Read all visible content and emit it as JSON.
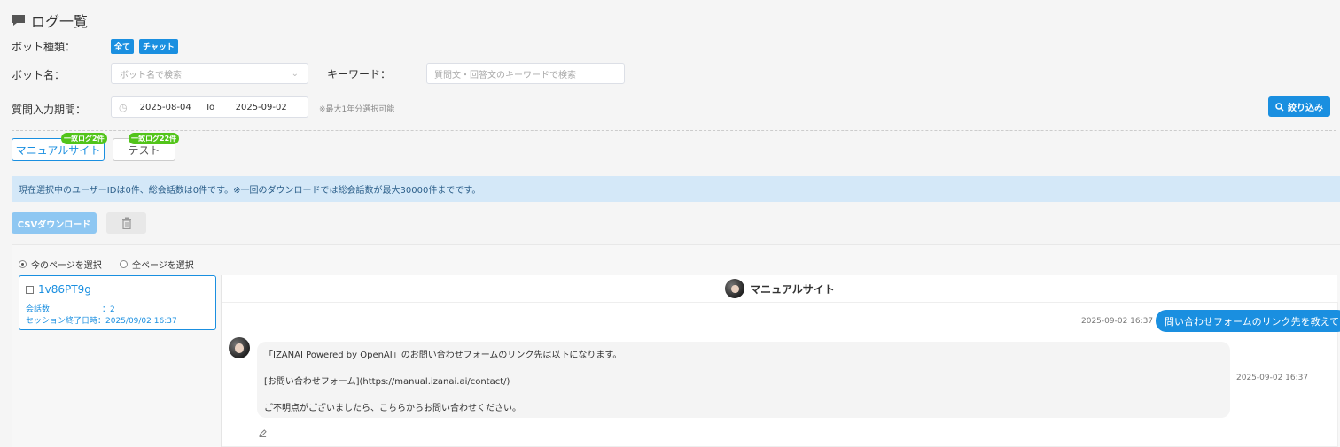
{
  "page": {
    "title": "ログ一覧"
  },
  "filters": {
    "bot_type_label": "ボット種類：",
    "bot_type_tags": [
      "全て",
      "チャット"
    ],
    "bot_name_label": "ボット名：",
    "bot_name_placeholder": "ボット名で検索",
    "keyword_label": "キーワード：",
    "keyword_placeholder": "質問文・回答文のキーワードで検索",
    "period_label": "質問入力期間：",
    "date_from": "2025-08-04",
    "date_to_sep": "To",
    "date_to": "2025-09-02",
    "period_note": "※最大1年分選択可能",
    "filter_button": "絞り込み"
  },
  "bot_tabs": [
    {
      "label": "マニュアルサイト",
      "badge": "一致ログ2件",
      "active": true
    },
    {
      "label": "テスト",
      "badge": "一致ログ22件",
      "active": false
    }
  ],
  "info_bar": "現在選択中のユーザーIDは0件、総会話数は0件です。※一回のダウンロードでは総会話数が最大30000件までです。",
  "actions": {
    "csv_button": "CSVダウンロード"
  },
  "selection": {
    "current_page": "今のページを選択",
    "all_pages": "全ページを選択",
    "selected": "current_page"
  },
  "sessions": [
    {
      "id": "1v86PT9g",
      "count_label": "会話数",
      "count_value": "：2",
      "end_label": "セッション終了日時",
      "end_value": "：2025/09/02 16:37"
    }
  ],
  "chat": {
    "bot_name": "マニュアルサイト",
    "user_message": "問い合わせフォームのリンク先を教えて",
    "user_time": "2025-09-02 16:37",
    "bot_lines": [
      "「IZANAI Powered by OpenAI」のお問い合わせフォームのリンク先は以下になります。",
      "[お問い合わせフォーム](https://manual.izanai.ai/contact/)",
      "ご不明点がございましたら、こちらからお問い合わせください。"
    ],
    "bot_time": "2025-09-02 16:37"
  },
  "colors": {
    "accent": "#1a8fe0",
    "badge": "#52c41a",
    "info_bg": "#d4e8f8"
  }
}
